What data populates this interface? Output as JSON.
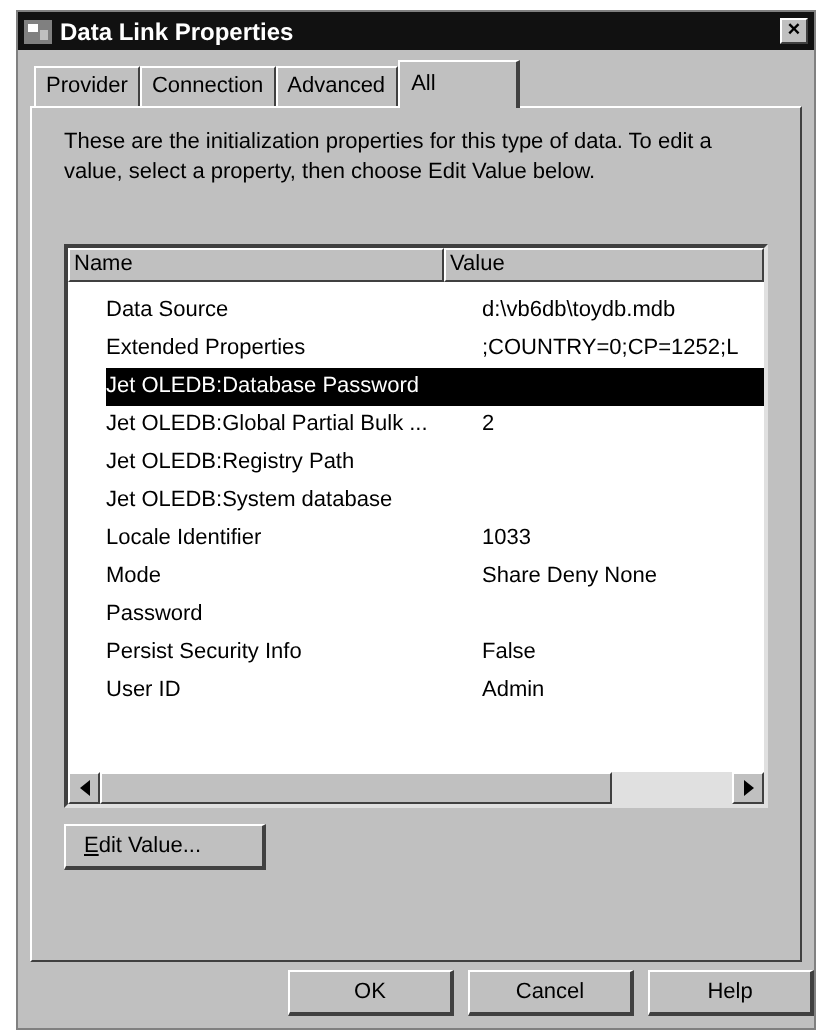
{
  "window": {
    "title": "Data Link Properties",
    "close": "×"
  },
  "tabs": [
    {
      "label": "Provider",
      "selected": false
    },
    {
      "label": "Connection",
      "selected": false
    },
    {
      "label": "Advanced",
      "selected": false
    },
    {
      "label": "All",
      "selected": true
    }
  ],
  "description": "These are the initialization properties for this type of data. To edit a value, select a property, then choose Edit Value below.",
  "table": {
    "columns": [
      "Name",
      "Value"
    ],
    "rows": [
      {
        "name": "Data Source",
        "value": "d:\\vb6db\\toydb.mdb",
        "selected": false
      },
      {
        "name": "Extended Properties",
        "value": ";COUNTRY=0;CP=1252;L",
        "selected": false
      },
      {
        "name": "Jet OLEDB:Database Password",
        "value": "",
        "selected": true
      },
      {
        "name": "Jet OLEDB:Global Partial Bulk ...",
        "value": "2",
        "selected": false
      },
      {
        "name": "Jet OLEDB:Registry Path",
        "value": "",
        "selected": false
      },
      {
        "name": "Jet OLEDB:System database",
        "value": "",
        "selected": false
      },
      {
        "name": "Locale Identifier",
        "value": "1033",
        "selected": false
      },
      {
        "name": "Mode",
        "value": "Share Deny None",
        "selected": false
      },
      {
        "name": "Password",
        "value": "",
        "selected": false
      },
      {
        "name": "Persist Security Info",
        "value": "False",
        "selected": false
      },
      {
        "name": "User ID",
        "value": "Admin",
        "selected": false
      }
    ]
  },
  "edit_button": "Edit Value...",
  "buttons": [
    "OK",
    "Cancel",
    "Help"
  ]
}
